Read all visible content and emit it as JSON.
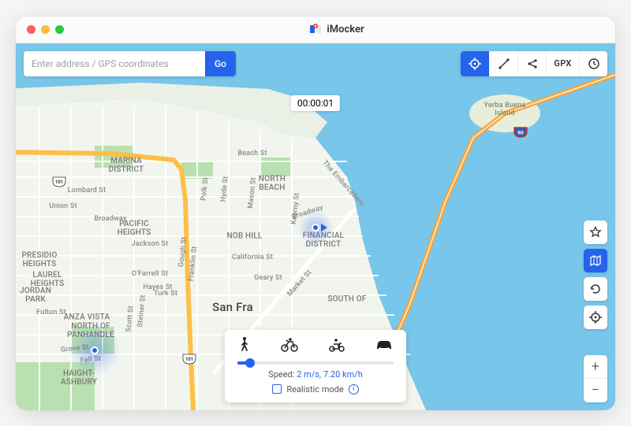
{
  "app": {
    "name": "iMocker"
  },
  "search": {
    "placeholder": "Enter address / GPS coordinates",
    "go_label": "Go"
  },
  "toolbar": {
    "gpx_label": "GPX"
  },
  "timer": {
    "value": "00:00:01"
  },
  "speed": {
    "label_prefix": "Speed: ",
    "value": "2 m/s, 7.20 km/h",
    "realistic_label": "Realistic mode"
  },
  "map": {
    "city_label": "San Fra",
    "yerba": {
      "line1": "Yerba Buena",
      "line2": "Island"
    },
    "districts": {
      "presidio_heights": "PRESIDIO\nHEIGHTS",
      "pacific_heights": "PACIFIC\nHEIGHTS",
      "laurel_heights": "LAUREL\nHEIGHTS",
      "jordan_park": "JORDAN\nPARK",
      "anza_vista": "ANZA VISTA",
      "north_panhandle": "NORTH OF\nPANHANDLE",
      "haight_ashbury": "HAIGHT-\nASHBURY",
      "marina": "MARINA\nDISTRICT",
      "nob_hill": "NOB HILL",
      "north_beach": "NORTH\nBEACH",
      "financial": "FINANCIAL\nDISTRICT",
      "south_of": "SOUTH OF"
    },
    "streets": {
      "lombard": "Lombard St",
      "union": "Union St",
      "broadway": "Broadway",
      "california": "California St",
      "geary": "Geary St",
      "turk": "Turk St",
      "fell": "Fell St",
      "grove": "Grove St",
      "steiner": "Steiner St",
      "scott": "Scott St",
      "ofarrell": "O'Farrell St",
      "hayes": "Hayes St",
      "franklin": "Franklin St",
      "polk": "Polk St",
      "hyde": "Hyde St",
      "mason": "Mason St",
      "kearny": "Kearny St",
      "jackson": "Jackson St",
      "beach": "Beach St",
      "market": "Market St",
      "fulton": "Fulton St",
      "embarcadero": "The Embarcadero",
      "gough": "Gough St"
    },
    "shields": {
      "hwy101": "101",
      "i80": "80"
    }
  }
}
